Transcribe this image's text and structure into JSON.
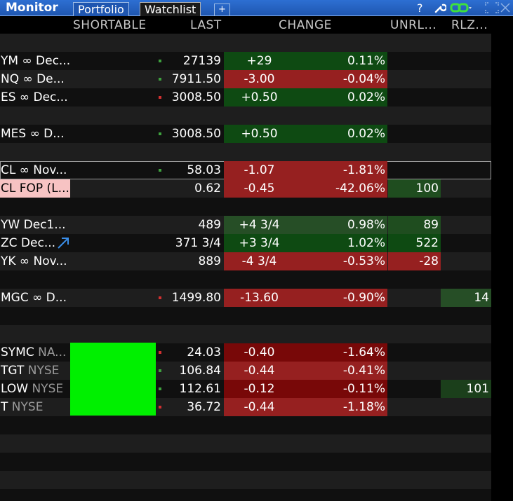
{
  "titlebar": {
    "app_title": "Monitor",
    "tabs": [
      "Portfolio",
      "Watchlist"
    ],
    "add_tab": "+",
    "help": "?"
  },
  "columns": [
    "SHORTABLE",
    "LAST",
    "CHANGE",
    "UNRL...",
    "RLZ..."
  ],
  "rows": [
    {
      "sym": "YM ∞ Dec...",
      "last": "27139",
      "chg": "+29",
      "pct": "0.11%",
      "unrl": "",
      "rlz": ""
    },
    {
      "sym": "NQ ∞ De...",
      "last": "7911.50",
      "chg": "-3.00",
      "pct": "-0.04%",
      "unrl": "",
      "rlz": ""
    },
    {
      "sym": "ES ∞ Dec...",
      "last": "3008.50",
      "chg": "+0.50",
      "pct": "0.02%",
      "unrl": "",
      "rlz": ""
    },
    {
      "sym": "MES ∞ D...",
      "last": "3008.50",
      "chg": "+0.50",
      "pct": "0.02%",
      "unrl": "",
      "rlz": ""
    },
    {
      "sym": "CL ∞ Nov...",
      "last": "58.03",
      "chg": "-1.07",
      "pct": "-1.81%",
      "unrl": "",
      "rlz": ""
    },
    {
      "sym": "CL FOP (L...",
      "last": "0.62",
      "chg": "-0.45",
      "pct": "-42.06%",
      "unrl": "100",
      "rlz": ""
    },
    {
      "sym": "YW Dec1...",
      "last": "489",
      "chg": "+4 3/4",
      "pct": "0.98%",
      "unrl": "89",
      "rlz": ""
    },
    {
      "sym": "ZC Dec...",
      "last": "371 3/4",
      "chg": "+3 3/4",
      "pct": "1.02%",
      "unrl": "522",
      "rlz": ""
    },
    {
      "sym": "YK ∞ Nov...",
      "last": "889",
      "chg": "-4 3/4",
      "pct": "-0.53%",
      "unrl": "-28",
      "rlz": ""
    },
    {
      "sym": "MGC ∞ D...",
      "last": "1499.80",
      "chg": "-13.60",
      "pct": "-0.90%",
      "unrl": "",
      "rlz": "14"
    },
    {
      "sym": "SYMC",
      "exch": "NA...",
      "last": "24.03",
      "chg": "-0.40",
      "pct": "-1.64%",
      "unrl": "",
      "rlz": ""
    },
    {
      "sym": "TGT",
      "exch": "NYSE",
      "last": "106.84",
      "chg": "-0.44",
      "pct": "-0.41%",
      "unrl": "",
      "rlz": ""
    },
    {
      "sym": "LOW",
      "exch": "NYSE",
      "last": "112.61",
      "chg": "-0.12",
      "pct": "-0.11%",
      "unrl": "",
      "rlz": "101"
    },
    {
      "sym": "T",
      "exch": "NYSE",
      "last": "36.72",
      "chg": "-0.44",
      "pct": "-1.18%",
      "unrl": "",
      "rlz": ""
    }
  ],
  "colors": {
    "titlebar": "#2d6fd2",
    "up": "#0e4a12",
    "down": "#962020",
    "shortable": "#00f000"
  }
}
